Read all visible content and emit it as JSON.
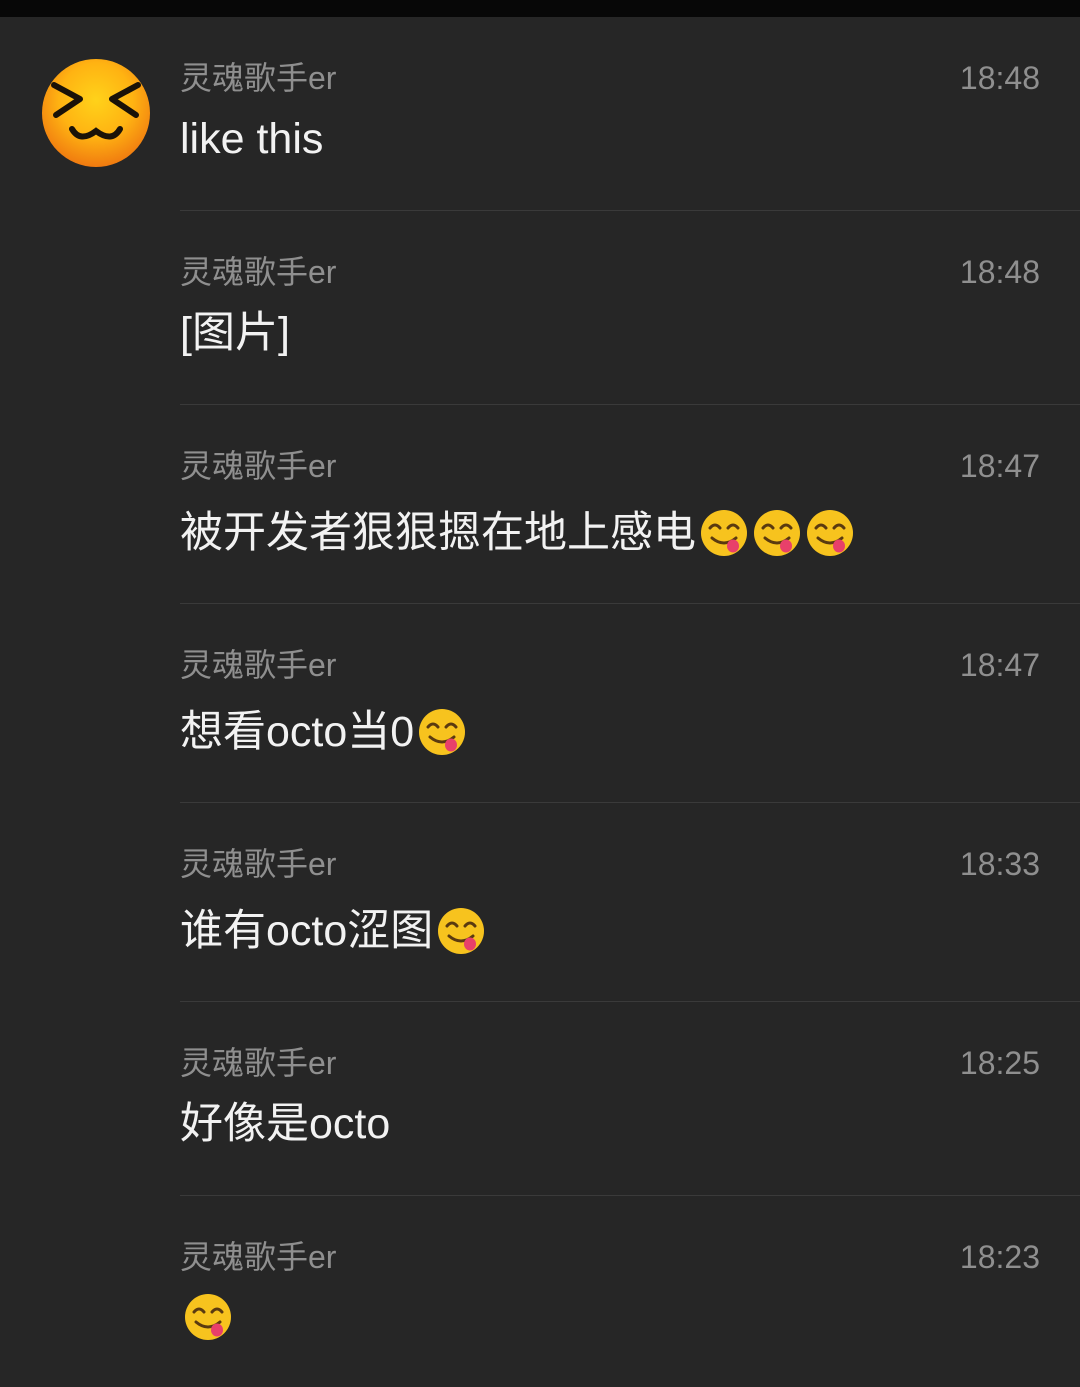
{
  "messages": [
    {
      "sender": "灵魂歌手er",
      "time": "18:48",
      "text": "like this",
      "emojis": 0,
      "show_avatar": true
    },
    {
      "sender": "灵魂歌手er",
      "time": "18:48",
      "text": "[图片]",
      "emojis": 0
    },
    {
      "sender": "灵魂歌手er",
      "time": "18:47",
      "text": "被开发者狠狠摁在地上感电",
      "emojis": 3
    },
    {
      "sender": "灵魂歌手er",
      "time": "18:47",
      "text": "想看octo当0",
      "emojis": 1
    },
    {
      "sender": "灵魂歌手er",
      "time": "18:33",
      "text": "谁有octo涩图",
      "emojis": 1
    },
    {
      "sender": "灵魂歌手er",
      "time": "18:25",
      "text": "好像是octo",
      "emojis": 0
    },
    {
      "sender": "灵魂歌手er",
      "time": "18:23",
      "text": "",
      "emojis": 1
    }
  ],
  "icons": {
    "avatar": "squinting-cat-face-avatar",
    "emoji": "face-savoring-food-emoji"
  },
  "colors": {
    "background": "#262626",
    "status_bar": "#070707",
    "secondary_text": "#8f8f8f",
    "primary_text": "#f2f2f2",
    "divider": "#3a3a3a",
    "emoji_yellow": "#f7c31e"
  }
}
